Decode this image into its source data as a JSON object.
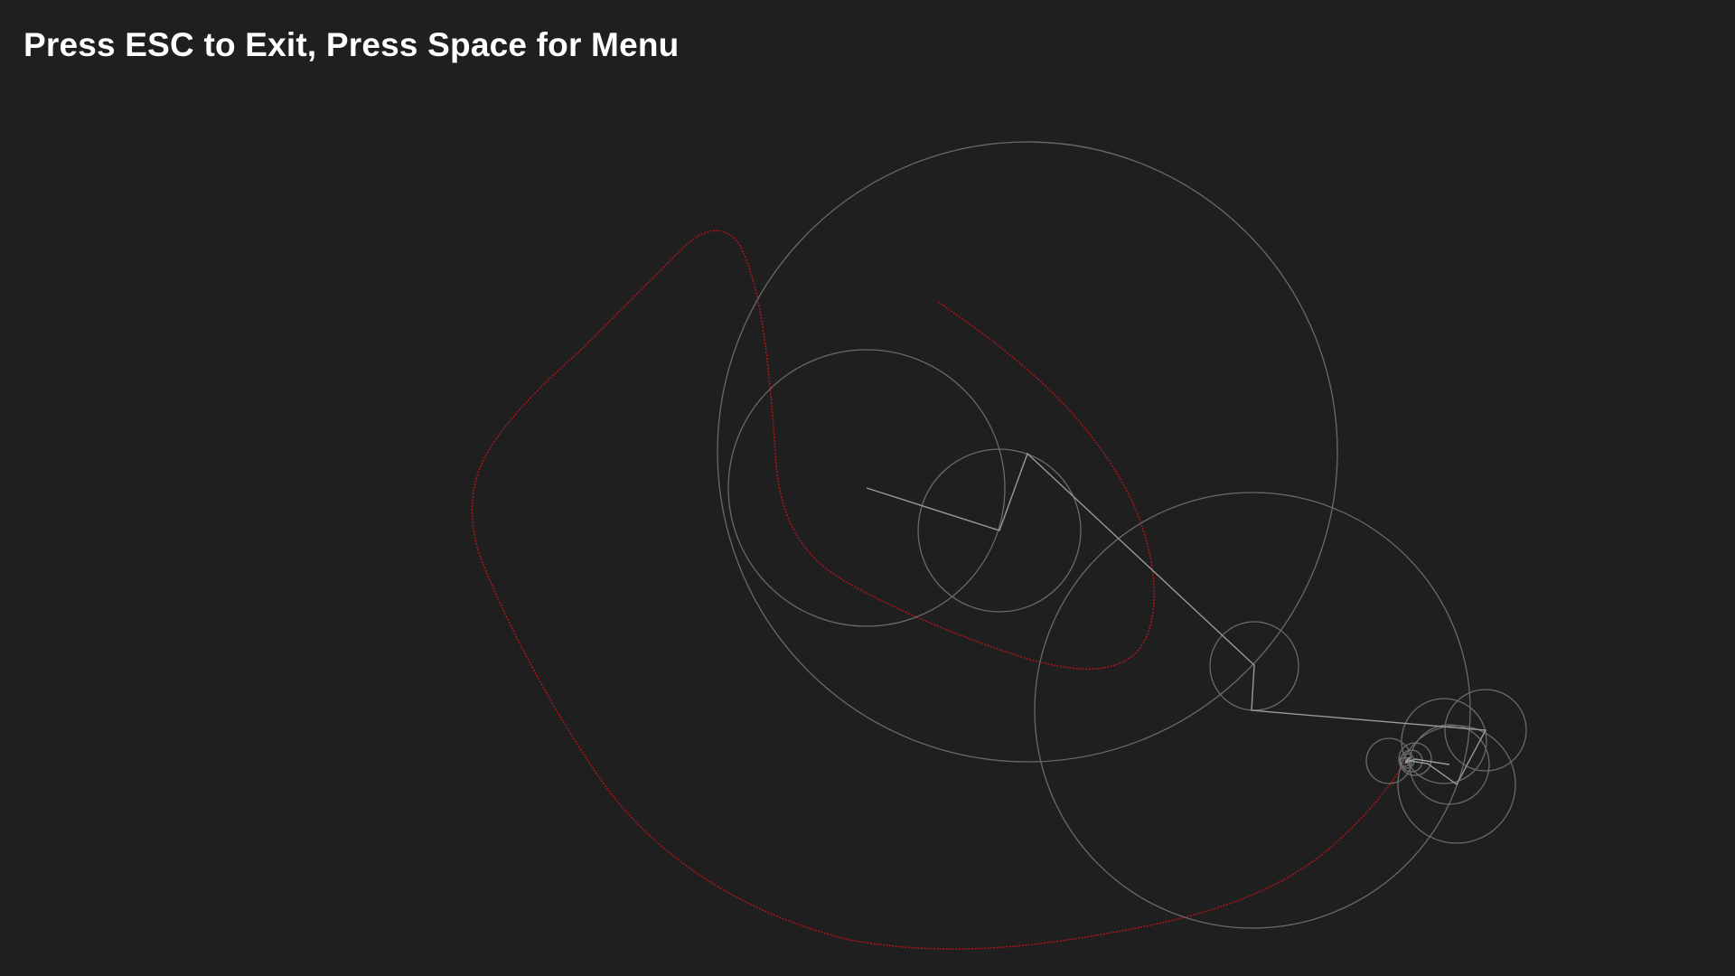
{
  "hud": {
    "instructions": "Press ESC to Exit, Press Space for Menu"
  },
  "colors": {
    "background": "#1f1f1f",
    "hud_text": "#ffffff",
    "circle_stroke": "#6a6a6a",
    "arm_stroke": "#9a9a9a",
    "trace_stroke": "#b0141b"
  }
}
